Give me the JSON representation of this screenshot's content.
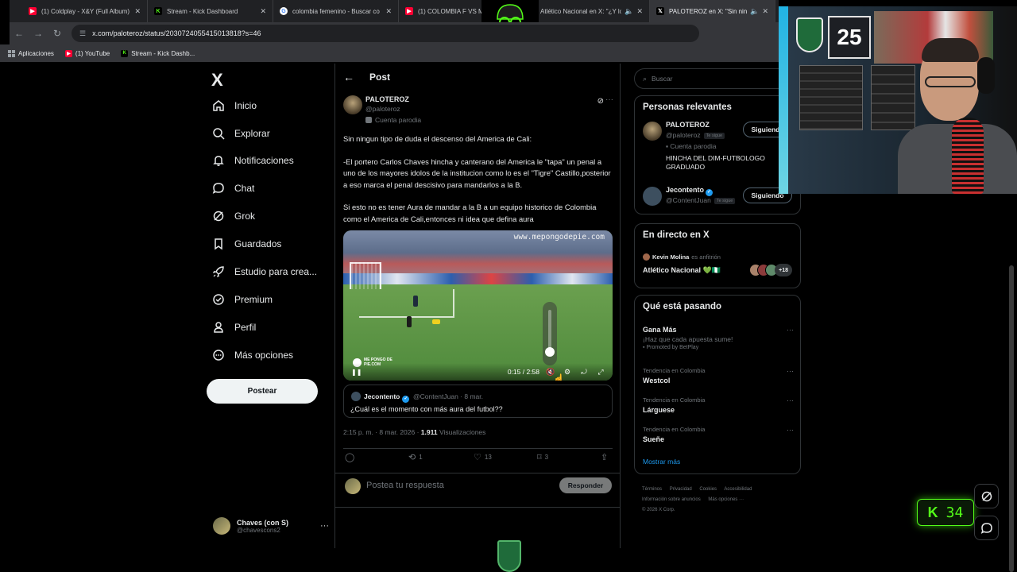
{
  "browser": {
    "tabs": [
      {
        "title": "(1) Coldplay - X&Y (Full Album)",
        "icon": "youtube-icon",
        "active": false
      },
      {
        "title": "Stream - Kick Dashboard",
        "icon": "kick-icon",
        "active": false
      },
      {
        "title": "colombia femenino - Buscar co",
        "icon": "google-icon",
        "active": false
      },
      {
        "title": "(1) COLOMBIA F VS M",
        "icon": "youtube-icon",
        "active": false
      },
      {
        "title": "Atlético Nacional en X: \"¿Y los",
        "icon": "x-icon",
        "active": false
      },
      {
        "title": "PALOTEROZ en X: \"Sin ningu",
        "icon": "x-icon",
        "active": true
      }
    ],
    "url": "x.com/paloteroz/status/2030724055415013818?s=46",
    "bookmarks": [
      {
        "label": "Aplicaciones",
        "icon": "apps-grid-icon"
      },
      {
        "label": "(1) YouTube",
        "icon": "youtube-icon"
      },
      {
        "label": "Stream - Kick Dashb...",
        "icon": "kick-icon"
      }
    ]
  },
  "nav": {
    "logo": "X",
    "items": [
      {
        "label": "Inicio",
        "icon": "home-icon"
      },
      {
        "label": "Explorar",
        "icon": "search-icon"
      },
      {
        "label": "Notificaciones",
        "icon": "bell-icon"
      },
      {
        "label": "Chat",
        "icon": "chat-bubble-icon"
      },
      {
        "label": "Grok",
        "icon": "grok-icon"
      },
      {
        "label": "Guardados",
        "icon": "bookmark-icon"
      },
      {
        "label": "Estudio para crea...",
        "icon": "rocket-icon"
      },
      {
        "label": "Premium",
        "icon": "verified-badge-icon"
      },
      {
        "label": "Perfil",
        "icon": "person-icon"
      },
      {
        "label": "Más opciones",
        "icon": "more-circle-icon"
      }
    ],
    "post_button": "Postear",
    "account": {
      "name": "Chaves (con S)",
      "handle": "@chavescons2",
      "more": "···"
    }
  },
  "post": {
    "header": "Post",
    "author": {
      "name": "PALOTEROZ",
      "handle": "@paloteroz",
      "parody": "Cuenta parodia"
    },
    "paragraphs": [
      "Sin ningun tipo de duda el descenso del America de Cali:",
      "-El portero Carlos Chaves hincha y canterano del America le \"tapa\" un penal a uno de los mayores idolos de la institucion como lo es el \"Tigre\" Castillo,posterior a eso marca el penal descisivo para mandarlos a la B.",
      "Si esto no es tener Aura de mandar a la B a un equipo historico de Colombia como el America de Cali,entonces ni idea que defina aura"
    ],
    "video": {
      "watermark": "www.mepongodepie.com",
      "logo_text": "ME PONGO DE PIE.COM",
      "time": "0:15 / 2:58",
      "volume": 0.05
    },
    "quote": {
      "name": "Jecontento",
      "handle": "@ContentJuan · 8 mar.",
      "text": "¿Cuál es el momento con más aura del futbol??"
    },
    "meta": {
      "time": "2:15 p. m. · 8 mar. 2026 · ",
      "views": "1.911",
      "views_label": " Visualizaciones"
    },
    "stats": {
      "retweets": "1",
      "likes": "13",
      "bookmarks": "3"
    },
    "reply": {
      "placeholder": "Postea tu respuesta",
      "button": "Responder"
    }
  },
  "sidebar": {
    "search_placeholder": "Buscar",
    "relevant": {
      "title": "Personas relevantes",
      "people": [
        {
          "name": "PALOTEROZ",
          "handle": "@paloteroz",
          "tag": "Te sigue",
          "parody": "Cuenta parodia",
          "bio": "HINCHA DEL DIM-FUTBOLOGO GRADUADO",
          "button": "Siguiendo"
        },
        {
          "name": "Jecontento",
          "handle": "@ContentJuan",
          "tag": "Te sigue",
          "button": "Siguiendo"
        }
      ]
    },
    "live": {
      "title": "En directo en X",
      "host": "Kevin Molina",
      "host_suffix": "es anfitrión",
      "space": "Atlético Nacional 💚🇳🇬",
      "extra": "+18"
    },
    "trends": {
      "title": "Qué está pasando",
      "items": [
        {
          "context": "",
          "name": "Gana Más",
          "desc": "¡Haz que cada apuesta sume!",
          "promo": "Promoted by BetPlay"
        },
        {
          "context": "Tendencia en Colombia",
          "name": "Westcol"
        },
        {
          "context": "Tendencia en Colombia",
          "name": "Lárguese"
        },
        {
          "context": "Tendencia en Colombia",
          "name": "Sueñe"
        }
      ],
      "show_more": "Mostrar más"
    },
    "footer": [
      "Términos",
      "Privacidad",
      "Cookies",
      "Accesibilidad",
      "Información sobre anuncios",
      "Más opciones ···",
      "© 2026 X Corp."
    ]
  },
  "overlay": {
    "jersey_number": "25",
    "kick_count": "34",
    "kick_logo": "K"
  },
  "colors": {
    "accent": "#1d9bf0",
    "kick": "#53fc18",
    "background": "#000000"
  }
}
